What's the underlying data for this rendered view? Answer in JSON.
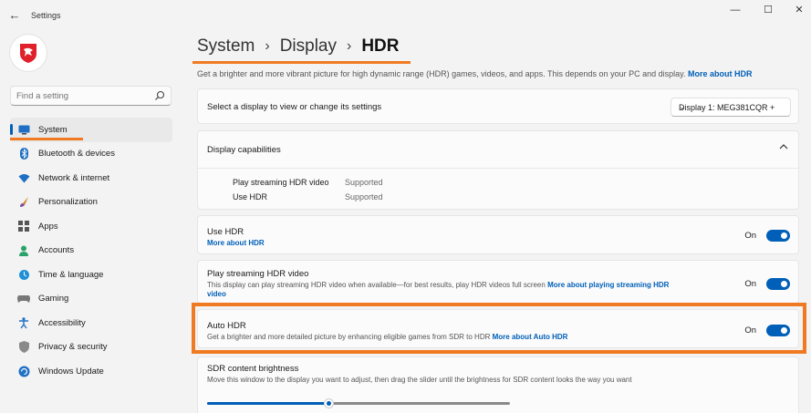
{
  "window": {
    "title": "Settings",
    "back_icon": "back-arrow-icon",
    "minimize_icon": "minimize-icon",
    "maximize_icon": "maximize-icon",
    "close_icon": "close-icon"
  },
  "search": {
    "placeholder": "Find a setting",
    "icon": "search-icon"
  },
  "sidebar": {
    "items": [
      {
        "label": "System",
        "icon": "display-icon",
        "active": true
      },
      {
        "label": "Bluetooth & devices",
        "icon": "bluetooth-icon"
      },
      {
        "label": "Network & internet",
        "icon": "wifi-icon"
      },
      {
        "label": "Personalization",
        "icon": "brush-icon"
      },
      {
        "label": "Apps",
        "icon": "apps-icon"
      },
      {
        "label": "Accounts",
        "icon": "person-icon"
      },
      {
        "label": "Time & language",
        "icon": "globe-clock-icon"
      },
      {
        "label": "Gaming",
        "icon": "gamepad-icon"
      },
      {
        "label": "Accessibility",
        "icon": "accessibility-icon"
      },
      {
        "label": "Privacy & security",
        "icon": "shield-icon"
      },
      {
        "label": "Windows Update",
        "icon": "update-icon"
      }
    ]
  },
  "breadcrumb": {
    "part1": "System",
    "part2": "Display",
    "current": "HDR",
    "separator": "›"
  },
  "subtitle": {
    "text": "Get a brighter and more vibrant picture for high dynamic range (HDR) games, videos, and apps. This depends on your PC and display.",
    "link": "More about HDR"
  },
  "select_display": {
    "label": "Select a display to view or change its settings",
    "value": "Display 1: MEG381CQR +",
    "chevron": "⌄"
  },
  "capabilities": {
    "title": "Display capabilities",
    "rows": [
      {
        "name": "Play streaming HDR video",
        "value": "Supported"
      },
      {
        "name": "Use HDR",
        "value": "Supported"
      }
    ]
  },
  "use_hdr": {
    "title": "Use HDR",
    "link": "More about HDR",
    "state": "On"
  },
  "streaming": {
    "title": "Play streaming HDR video",
    "desc": "This display can play streaming HDR video when available—for best results, play HDR videos full screen",
    "link1": "More about playing streaming HDR",
    "link2": "video",
    "state": "On"
  },
  "auto_hdr": {
    "title": "Auto HDR",
    "desc": "Get a brighter and more detailed picture by enhancing eligible games from SDR to HDR",
    "link": "More about Auto HDR",
    "state": "On"
  },
  "sdr": {
    "title": "SDR content brightness",
    "desc": "Move this window to the display you want to adjust, then drag the slider until the brightness for SDR content looks the way you want",
    "level": 0.4
  },
  "colors": {
    "accent": "#005fb8",
    "annotation": "#f07a22"
  }
}
